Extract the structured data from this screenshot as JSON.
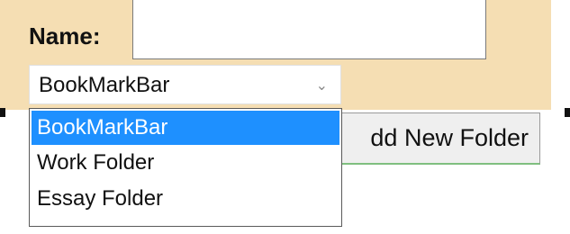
{
  "form": {
    "name_label": "Name:",
    "name_value": "",
    "folder_select": {
      "selected": "BookMarkBar",
      "options": [
        "BookMarkBar",
        "Work Folder",
        "Essay Folder"
      ],
      "arrow_icon": "chevron-down-icon"
    },
    "add_button_label": "dd New Folder"
  },
  "colors": {
    "panel_bg": "#f5deb3",
    "selected_option_bg": "#1e90ff"
  }
}
